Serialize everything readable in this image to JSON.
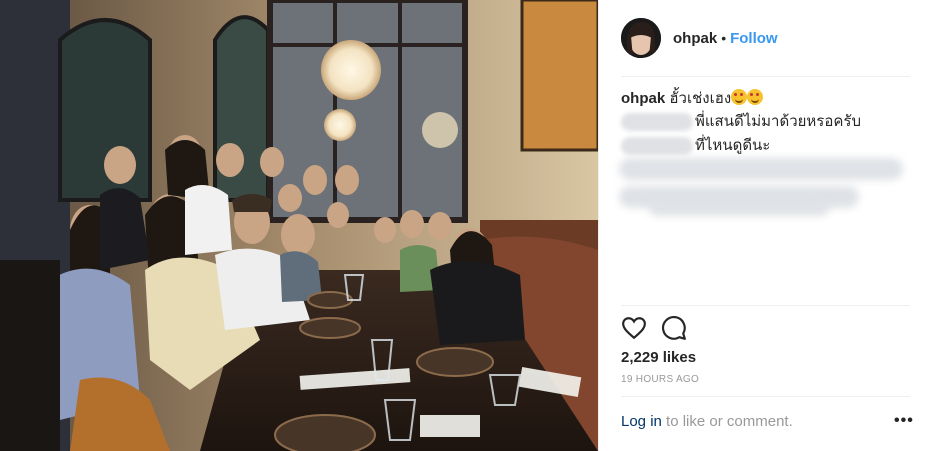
{
  "post": {
    "username": "ohpak",
    "separator": "•",
    "follow_label": "Follow",
    "caption_text": "ฮั้วเช่งเฮง",
    "caption_emojis": [
      "heart-eyes-emoji",
      "grin-emoji"
    ],
    "comments": [
      {
        "text": "พี่แสนดีไม่มาด้วยหรอครับ"
      },
      {
        "text": "ที่ไหนดูดีนะ"
      }
    ],
    "likes": "2,229 likes",
    "timestamp": "19 HOURS AGO",
    "login_link": "Log in",
    "login_rest": " to like or comment.",
    "more_label": "•••"
  },
  "icons": [
    "heart-icon",
    "comment-icon"
  ],
  "colors": {
    "link": "#3897f0",
    "text": "#262626",
    "muted": "#999999"
  }
}
